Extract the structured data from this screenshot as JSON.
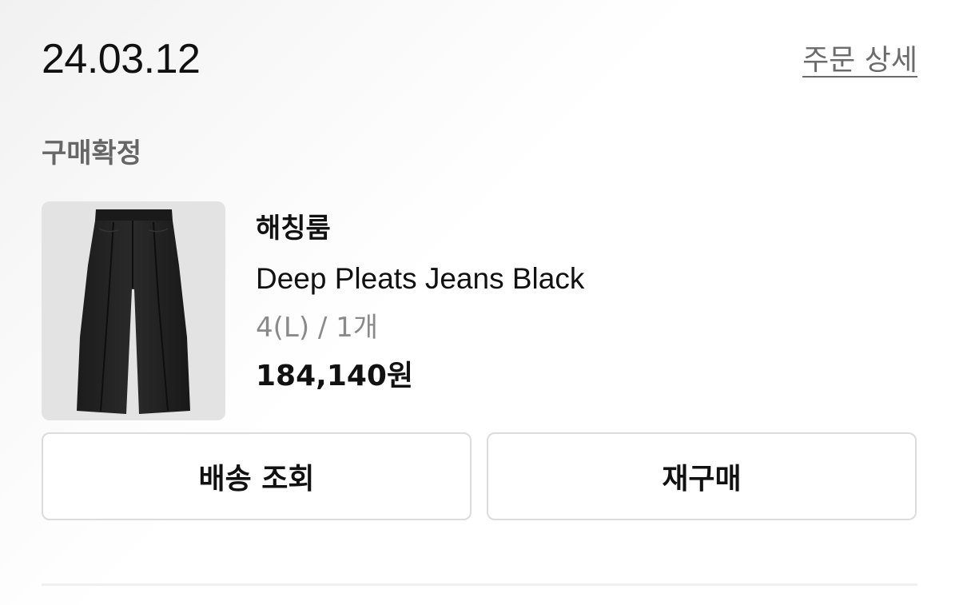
{
  "order": {
    "date": "24.03.12",
    "detail_link": "주문 상세",
    "status": "구매확정"
  },
  "product": {
    "image_icon": "black-wide-pants-photo",
    "brand": "해칭룸",
    "name": "Deep Pleats Jeans Black",
    "option": "4(L) / 1개",
    "price": "184,140원"
  },
  "actions": {
    "tracking_label": "배송 조회",
    "reorder_label": "재구매"
  },
  "colors": {
    "text": "#111111",
    "muted": "#8a8a8a",
    "border": "#dcdcdc",
    "thumb_bg": "#e3e3e3"
  }
}
